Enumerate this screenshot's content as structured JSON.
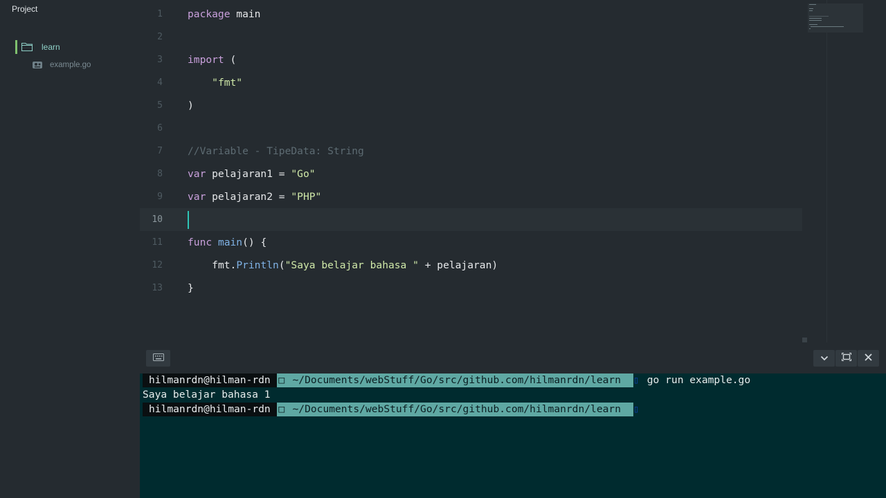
{
  "sidebar": {
    "title": "Project",
    "root_folder": "learn",
    "files": [
      "example.go"
    ]
  },
  "editor": {
    "line_numbers": [
      "1",
      "2",
      "3",
      "4",
      "5",
      "6",
      "7",
      "8",
      "9",
      "10",
      "11",
      "12",
      "13"
    ],
    "code": {
      "l1_kw": "package",
      "l1_rest": " main",
      "l3_kw": "import",
      "l3_rest": " (",
      "l4_str": "\"fmt\"",
      "l5": ")",
      "l7_comment": "//Variable - TipeData: String",
      "l8_kw": "var",
      "l8_name": " pelajaran1 = ",
      "l8_str": "\"Go\"",
      "l9_kw": "var",
      "l9_name": " pelajaran2 = ",
      "l9_str": "\"PHP\"",
      "l11_kw": "func",
      "l11_fn": "main",
      "l11_rest": "() {",
      "l12_obj": "fmt.",
      "l12_fn": "Println",
      "l12_open": "(",
      "l12_str": "\"Saya belajar bahasa \"",
      "l12_rest": " + pelajaran)",
      "l13": "}"
    },
    "active_line": "10",
    "colors": {
      "keyword": "#c9a0dc",
      "function": "#7fb2e5",
      "string": "#cfe8a8",
      "comment": "#5d6b72",
      "cursor": "#2ec4b6"
    }
  },
  "terminal_toolbar": {
    "keyboard_icon": "keyboard-icon",
    "buttons": [
      "chevron-down-icon",
      "maximize-icon",
      "close-icon"
    ]
  },
  "terminal": {
    "prompt_user": "hilmanrdn@hilman-rdn",
    "prompt_path": " ~/Documents/webStuff/Go/src/github.com/hilmanrdn/learn ",
    "command": "go run example.go",
    "output": "Saya belajar bahasa 1",
    "colors": {
      "background": "#002b2f",
      "path_segment": "#5fa8a3"
    }
  }
}
